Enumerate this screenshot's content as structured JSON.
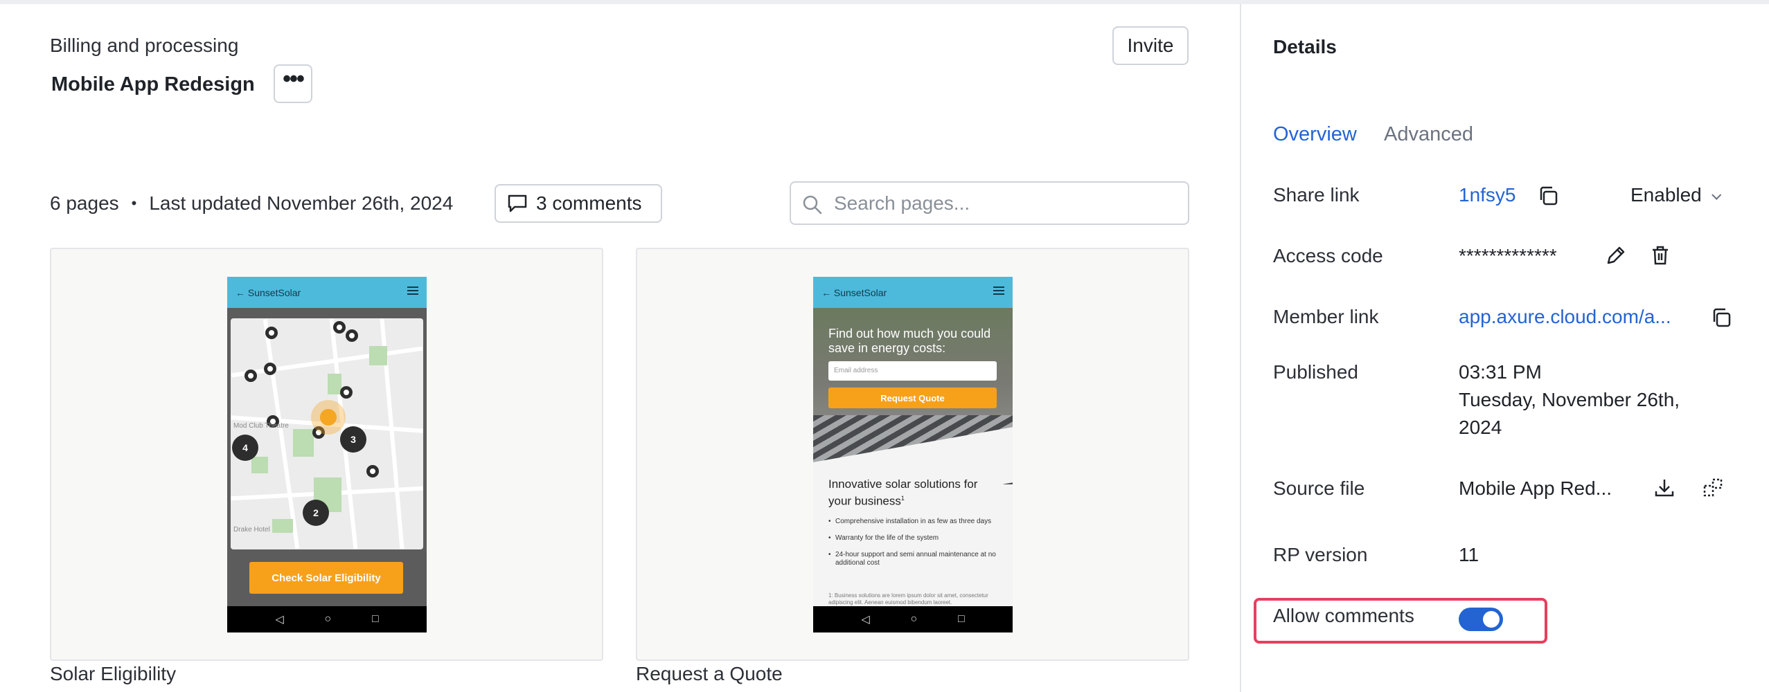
{
  "header": {
    "breadcrumb": "Billing and processing",
    "project_title": "Mobile App Redesign",
    "more_label": "•••",
    "invite_label": "Invite"
  },
  "meta": {
    "pages": "6 pages",
    "separator": "•",
    "last_updated": "Last updated November 26th, 2024",
    "comments_label": "3 comments"
  },
  "search": {
    "placeholder": "Search pages..."
  },
  "pages": [
    {
      "label": "Solar Eligibility",
      "mock": {
        "brand": "← SunsetSolar",
        "button": "Check Solar Eligibility",
        "map_labels": [
          "Mod Club Theatre",
          "Drake Hotel"
        ],
        "clusters": [
          "4",
          "3",
          "2"
        ],
        "nav": [
          "◁",
          "○",
          "□"
        ]
      }
    },
    {
      "label": "Request a Quote",
      "mock": {
        "brand": "← SunsetSolar",
        "hero_text": "Find out how much you could save in energy costs:",
        "email_placeholder": "Email address",
        "button": "Request Quote",
        "section_title": "Innovative solar solutions for your business",
        "section_title_sup": "1",
        "bullets": [
          "Comprehensive installation in as few as three days",
          "Warranty for the life of the system",
          "24-hour support and semi annual maintenance at no additional cost"
        ],
        "footnote": "1: Business solutions are lorem ipsum dolor sit amet, consectetur adipiscing elit. Aenean euismod bibendum laoreet.",
        "nav": [
          "◁",
          "○",
          "□"
        ]
      }
    }
  ],
  "details": {
    "title": "Details",
    "tabs": {
      "overview": "Overview",
      "advanced": "Advanced"
    },
    "share_link": {
      "label": "Share link",
      "value": "1nfsy5",
      "status": "Enabled"
    },
    "access_code": {
      "label": "Access code",
      "value": "*************"
    },
    "member_link": {
      "label": "Member link",
      "value": "app.axure.cloud.com/a..."
    },
    "published": {
      "label": "Published",
      "time": "03:31 PM",
      "date_line1": "Tuesday, November 26th,",
      "date_line2": "2024"
    },
    "source_file": {
      "label": "Source file",
      "value": "Mobile App Red..."
    },
    "rp_version": {
      "label": "RP version",
      "value": "11"
    },
    "allow_comments": {
      "label": "Allow comments",
      "enabled": true
    }
  },
  "colors": {
    "accent": "#2364d2",
    "highlight": "#e5405e",
    "mock_header": "#4ebadb",
    "mock_button": "#f7a11a"
  }
}
